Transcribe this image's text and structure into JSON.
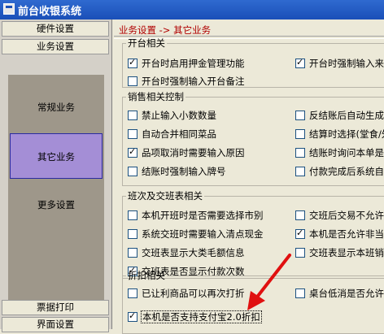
{
  "window": {
    "title": "前台收银系统"
  },
  "sidebar": {
    "top_buttons": [
      "硬件设置",
      "业务设置"
    ],
    "panel_items": [
      "常规业务",
      "其它业务",
      "更多设置"
    ],
    "selected": "其它业务",
    "bottom_buttons": [
      "票据打印",
      "界面设置"
    ]
  },
  "breadcrumb": "业务设置 -> 其它业务",
  "groups": {
    "open": {
      "title": "开台相关",
      "options": [
        {
          "label": "开台时启用押金管理功能",
          "checked": true
        },
        {
          "label": "开台时强制输入来客",
          "checked": true
        },
        {
          "label": "开台时强制输入开台备注",
          "checked": false
        }
      ]
    },
    "sales": {
      "title": "销售相关控制",
      "options": [
        {
          "label": "禁止输入小数数量",
          "checked": false
        },
        {
          "label": "反结账后自动生成",
          "checked": false
        },
        {
          "label": "自动合并相同菜品",
          "checked": false
        },
        {
          "label": "结算时选择(堂食/外",
          "checked": false
        },
        {
          "label": "品项取消时需要输入原因",
          "checked": true
        },
        {
          "label": "结账时询问本单是否",
          "checked": false
        },
        {
          "label": "结账时强制输入牌号",
          "checked": false
        },
        {
          "label": "付款完成后系统自动",
          "checked": false
        }
      ]
    },
    "shift": {
      "title": "班次及交班表相关",
      "options": [
        {
          "label": "本机开班时是否需要选择市别",
          "checked": false
        },
        {
          "label": "交班后交易不允许",
          "checked": false
        },
        {
          "label": "系统交班时需要输入清点现金",
          "checked": false
        },
        {
          "label": "本机是否允许非当前",
          "checked": true
        },
        {
          "label": "交班表显示大类毛额信息",
          "checked": false
        },
        {
          "label": "交班表显示本班销",
          "checked": false
        },
        {
          "label": "交班表是否显示付款次数",
          "checked": true
        }
      ]
    },
    "discount": {
      "title": "折扣相关",
      "options": [
        {
          "label": "已让利商品可以再次打折",
          "checked": false
        },
        {
          "label": "桌台低消是否允许",
          "checked": false
        },
        {
          "label": "本机是否支持支付宝2.0折扣",
          "checked": true
        }
      ]
    }
  }
}
